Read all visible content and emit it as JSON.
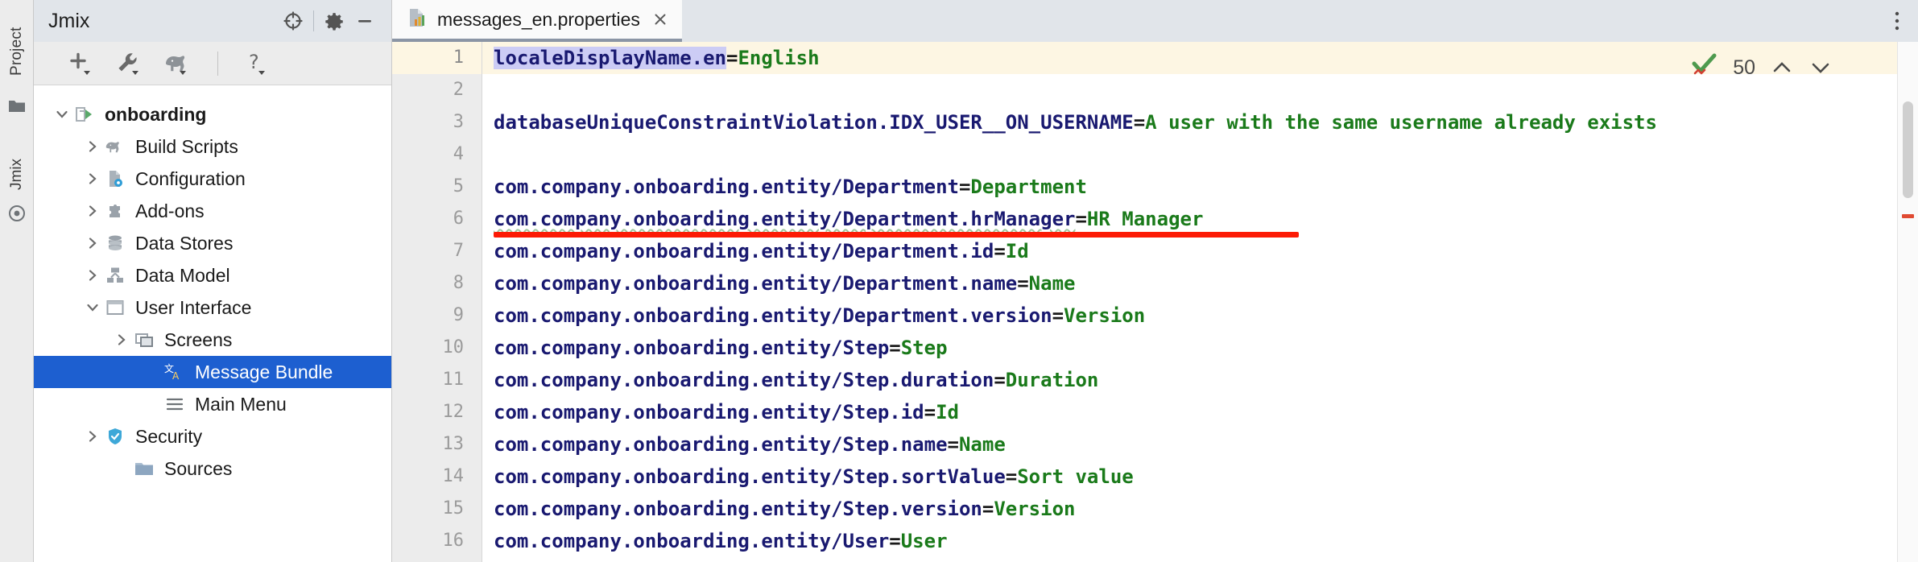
{
  "rail": {
    "project_label": "Project",
    "jmix_label": "Jmix",
    "folder_icon": "folder-icon",
    "bean_icon": "jmix-bean-icon"
  },
  "panel": {
    "title": "Jmix",
    "header_buttons": [
      {
        "name": "locate-in-tree-icon",
        "label": "Select Opened File"
      },
      {
        "name": "gear-icon",
        "label": "Settings"
      },
      {
        "name": "minimize-icon",
        "label": "Hide"
      }
    ],
    "toolbar_buttons": [
      {
        "name": "new-icon",
        "label": "New"
      },
      {
        "name": "wrench-icon",
        "label": "Tools"
      },
      {
        "name": "gradle-elephant-icon",
        "label": "Gradle"
      },
      {
        "name": "help-icon",
        "label": "Help"
      }
    ]
  },
  "tree": [
    {
      "label": "onboarding",
      "icon": "jmix-project-icon",
      "indent": 0,
      "arrow": "down",
      "selected": false,
      "bold": true
    },
    {
      "label": "Build Scripts",
      "icon": "gradle-elephant-icon",
      "indent": 1,
      "arrow": "right",
      "selected": false,
      "bold": false
    },
    {
      "label": "Configuration",
      "icon": "configuration-icon",
      "indent": 1,
      "arrow": "right",
      "selected": false,
      "bold": false
    },
    {
      "label": "Add-ons",
      "icon": "puzzle-icon",
      "indent": 1,
      "arrow": "right",
      "selected": false,
      "bold": false
    },
    {
      "label": "Data Stores",
      "icon": "database-icon",
      "indent": 1,
      "arrow": "right",
      "selected": false,
      "bold": false
    },
    {
      "label": "Data Model",
      "icon": "data-model-icon",
      "indent": 1,
      "arrow": "right",
      "selected": false,
      "bold": false
    },
    {
      "label": "User Interface",
      "icon": "window-icon",
      "indent": 1,
      "arrow": "down",
      "selected": false,
      "bold": false
    },
    {
      "label": "Screens",
      "icon": "screens-icon",
      "indent": 2,
      "arrow": "right",
      "selected": false,
      "bold": false
    },
    {
      "label": "Message Bundle",
      "icon": "message-bundle-icon",
      "indent": 3,
      "arrow": "none",
      "selected": true,
      "bold": false
    },
    {
      "label": "Main Menu",
      "icon": "main-menu-icon",
      "indent": 3,
      "arrow": "none",
      "selected": false,
      "bold": false
    },
    {
      "label": "Security",
      "icon": "shield-icon",
      "indent": 1,
      "arrow": "right",
      "selected": false,
      "bold": false
    },
    {
      "label": "Sources",
      "icon": "sources-folder-icon",
      "indent": 2,
      "arrow": "none",
      "selected": false,
      "bold": false
    }
  ],
  "editor": {
    "tab": {
      "label": "messages_en.properties",
      "icon": "properties-file-icon",
      "close_icon": "close-icon"
    },
    "kebab_icon": "more-options-icon",
    "inspection": {
      "status_icon": "inspection-ok-icon",
      "count": "50",
      "prev_icon": "chevron-up-icon",
      "next_icon": "chevron-down-icon"
    },
    "lines": [
      {
        "n": "1",
        "key": "localeDisplayName.en",
        "value": "English",
        "current": true,
        "key_selected": true
      },
      {
        "n": "2",
        "key": "",
        "value": "",
        "current": false,
        "key_selected": false
      },
      {
        "n": "3",
        "key": "databaseUniqueConstraintViolation.IDX_USER__ON_USERNAME",
        "value": "A user with the same username already exists",
        "current": false,
        "key_selected": false
      },
      {
        "n": "4",
        "key": "",
        "value": "",
        "current": false,
        "key_selected": false
      },
      {
        "n": "5",
        "key": "com.company.onboarding.entity/Department",
        "value": "Department",
        "current": false,
        "key_selected": false
      },
      {
        "n": "6",
        "key": "com.company.onboarding.entity/Department.hrManager",
        "value": "HR Manager",
        "current": false,
        "key_selected": false,
        "typo": true,
        "annotated": true
      },
      {
        "n": "7",
        "key": "com.company.onboarding.entity/Department.id",
        "value": "Id",
        "current": false,
        "key_selected": false
      },
      {
        "n": "8",
        "key": "com.company.onboarding.entity/Department.name",
        "value": "Name",
        "current": false,
        "key_selected": false
      },
      {
        "n": "9",
        "key": "com.company.onboarding.entity/Department.version",
        "value": "Version",
        "current": false,
        "key_selected": false
      },
      {
        "n": "10",
        "key": "com.company.onboarding.entity/Step",
        "value": "Step",
        "current": false,
        "key_selected": false
      },
      {
        "n": "11",
        "key": "com.company.onboarding.entity/Step.duration",
        "value": "Duration",
        "current": false,
        "key_selected": false
      },
      {
        "n": "12",
        "key": "com.company.onboarding.entity/Step.id",
        "value": "Id",
        "current": false,
        "key_selected": false
      },
      {
        "n": "13",
        "key": "com.company.onboarding.entity/Step.name",
        "value": "Name",
        "current": false,
        "key_selected": false
      },
      {
        "n": "14",
        "key": "com.company.onboarding.entity/Step.sortValue",
        "value": "Sort value",
        "current": false,
        "key_selected": false
      },
      {
        "n": "15",
        "key": "com.company.onboarding.entity/Step.version",
        "value": "Version",
        "current": false,
        "key_selected": false
      },
      {
        "n": "16",
        "key": "com.company.onboarding.entity/User",
        "value": "User",
        "current": false,
        "key_selected": false
      }
    ]
  },
  "colors": {
    "selection_blue": "#1d5fd0",
    "key_navy": "#191970",
    "value_green": "#1a7a1a",
    "caret_line": "#fdf6e3",
    "annotation_red": "#fc1b05",
    "panel_header": "#e1e5ea"
  }
}
